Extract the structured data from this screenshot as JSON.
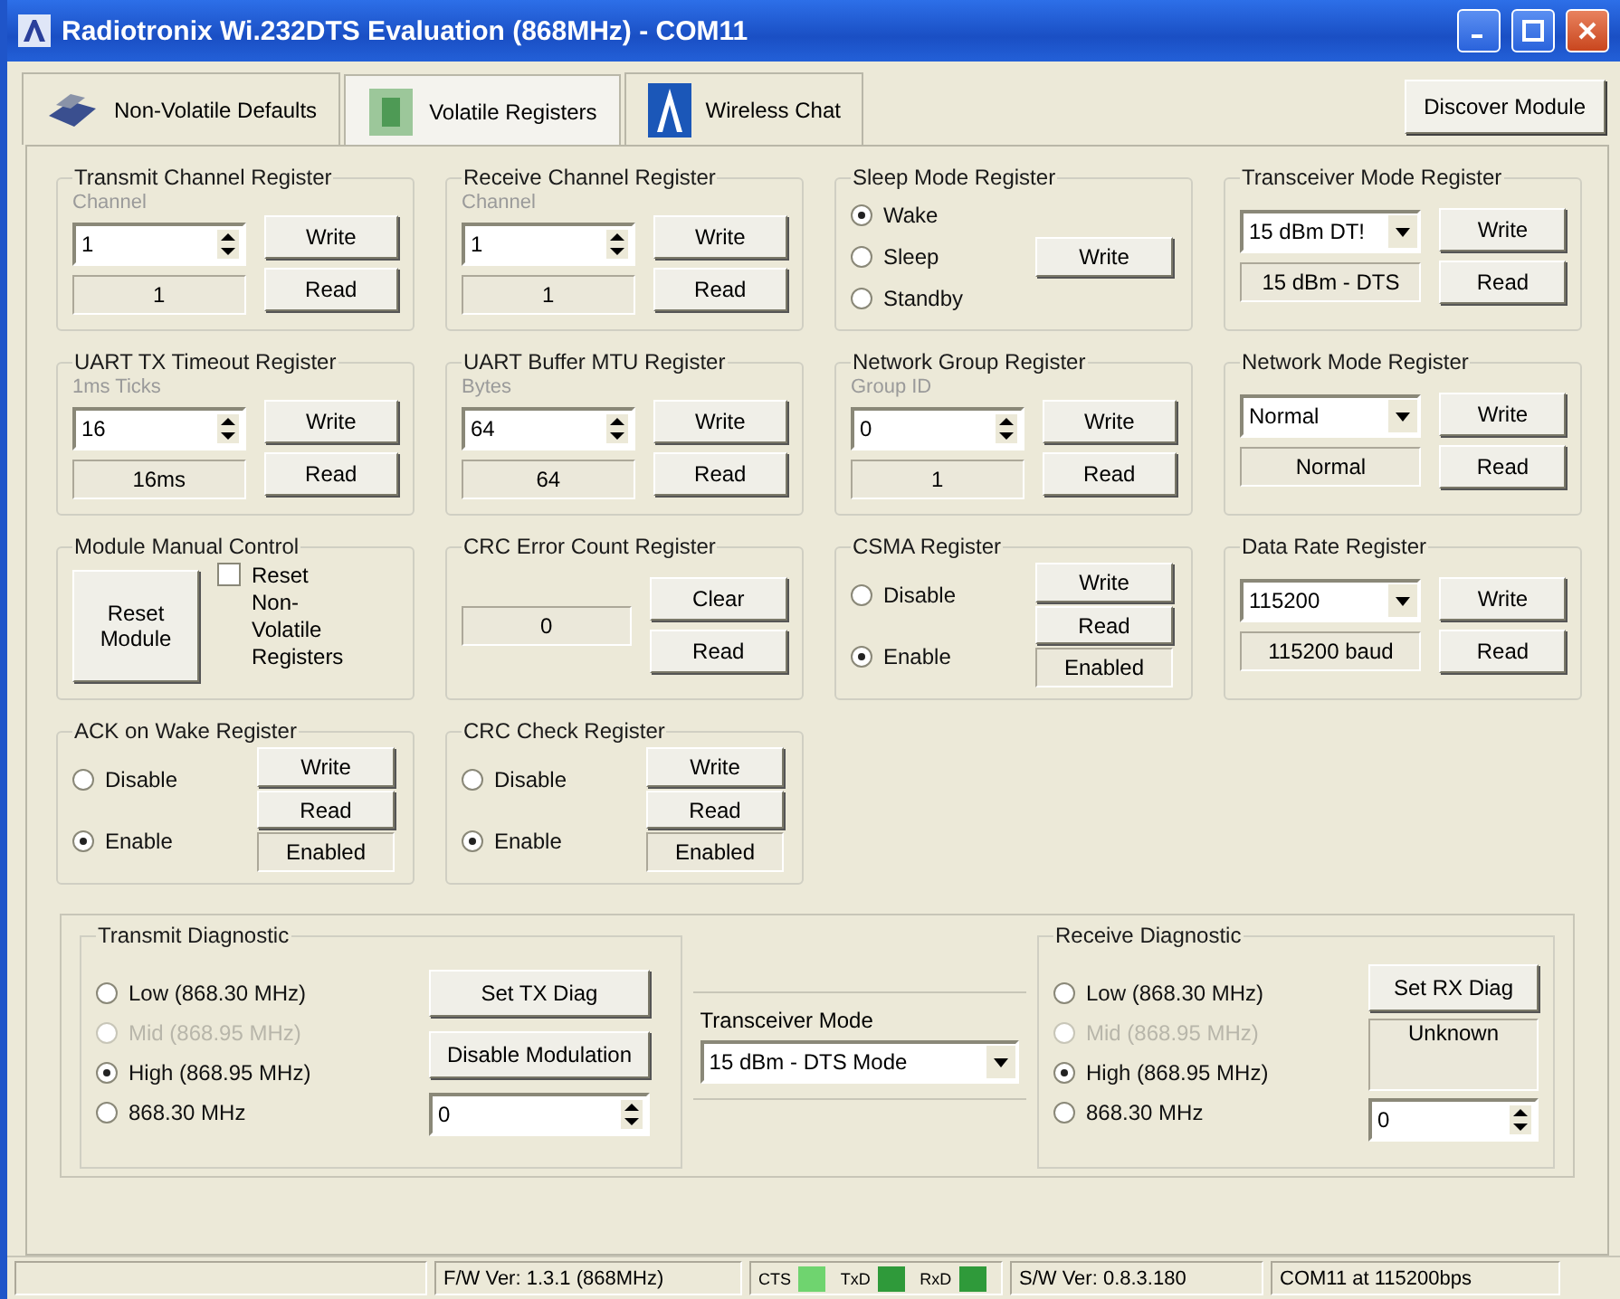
{
  "window": {
    "title": "Radiotronix Wi.232DTS Evaluation (868MHz) - COM11"
  },
  "tabs": [
    {
      "label": "Non-Volatile Defaults",
      "selected": false,
      "kind": "drive"
    },
    {
      "label": "Volatile Registers",
      "selected": true,
      "kind": "chip"
    },
    {
      "label": "Wireless Chat",
      "selected": false,
      "kind": "tower"
    }
  ],
  "discover_button": "Discover Module",
  "groups": [
    {
      "kind": "spin",
      "title": "Transmit Channel Register",
      "caption": "Channel",
      "value": "1",
      "readout": "1",
      "buttons": [
        "Write",
        "Read"
      ]
    },
    {
      "kind": "spin",
      "title": "Receive Channel Register",
      "caption": "Channel",
      "value": "1",
      "readout": "1",
      "buttons": [
        "Write",
        "Read"
      ]
    },
    {
      "kind": "radio",
      "title": "Sleep Mode Register",
      "options": [
        {
          "label": "Wake",
          "selected": true
        },
        {
          "label": "Sleep",
          "selected": false
        },
        {
          "label": "Standby",
          "selected": false
        }
      ],
      "buttons": [
        "Write"
      ]
    },
    {
      "kind": "combo",
      "title": "Transceiver Mode Register",
      "value": "15 dBm DT!",
      "readout": "15 dBm - DTS",
      "buttons": [
        "Write",
        "Read"
      ]
    },
    {
      "kind": "spin",
      "title": "UART TX Timeout Register",
      "caption": "1ms Ticks",
      "value": "16",
      "readout": "16ms",
      "buttons": [
        "Write",
        "Read"
      ]
    },
    {
      "kind": "spin",
      "title": "UART Buffer MTU Register",
      "caption": "Bytes",
      "value": "64",
      "readout": "64",
      "buttons": [
        "Write",
        "Read"
      ]
    },
    {
      "kind": "spin",
      "title": "Network Group Register",
      "caption": "Group ID",
      "value": "0",
      "readout": "1",
      "buttons": [
        "Write",
        "Read"
      ]
    },
    {
      "kind": "combo",
      "title": "Network Mode Register",
      "value": "Normal",
      "readout": "Normal",
      "buttons": [
        "Write",
        "Read"
      ]
    },
    {
      "kind": "reset",
      "title": "Module Manual Control",
      "buttons": [
        "Reset Module"
      ],
      "checkbox": {
        "label": "Reset Non-Volatile Registers",
        "checked": false
      }
    },
    {
      "kind": "counter",
      "title": "CRC Error Count Register",
      "readout": "0",
      "buttons": [
        "Clear",
        "Read"
      ]
    },
    {
      "kind": "radio",
      "title": "CSMA Register",
      "options": [
        {
          "label": "Disable",
          "selected": false
        },
        {
          "label": "Enable",
          "selected": true
        }
      ],
      "buttons": [
        "Write",
        "Read"
      ],
      "readout": "Enabled"
    },
    {
      "kind": "combo",
      "title": "Data Rate Register",
      "value": "115200",
      "readout": "115200 baud",
      "buttons": [
        "Write",
        "Read"
      ]
    },
    {
      "kind": "radio",
      "title": "ACK on Wake Register",
      "options": [
        {
          "label": "Disable",
          "selected": false
        },
        {
          "label": "Enable",
          "selected": true
        }
      ],
      "buttons": [
        "Write",
        "Read"
      ],
      "readout": "Enabled"
    },
    {
      "kind": "radio",
      "title": "CRC Check Register",
      "options": [
        {
          "label": "Disable",
          "selected": false
        },
        {
          "label": "Enable",
          "selected": true
        }
      ],
      "buttons": [
        "Write",
        "Read"
      ],
      "readout": "Enabled"
    }
  ],
  "transmit_diagnostic": {
    "title": "Transmit Diagnostic",
    "options": [
      {
        "label": "Low (868.30 MHz)",
        "selected": false,
        "disabled": false
      },
      {
        "label": "Mid (868.95 MHz)",
        "selected": false,
        "disabled": true
      },
      {
        "label": "High (868.95 MHz)",
        "selected": true,
        "disabled": false
      },
      {
        "label": "868.30 MHz",
        "selected": false,
        "disabled": false
      }
    ],
    "buttons": [
      "Set TX Diag",
      "Disable Modulation"
    ],
    "value": "0"
  },
  "transceiver_mode": {
    "label": "Transceiver Mode",
    "value": "15 dBm - DTS Mode"
  },
  "receive_diagnostic": {
    "title": "Receive Diagnostic",
    "options": [
      {
        "label": "Low (868.30 MHz)",
        "selected": false,
        "disabled": false
      },
      {
        "label": "Mid (868.95 MHz)",
        "selected": false,
        "disabled": true
      },
      {
        "label": "High (868.95 MHz)",
        "selected": true,
        "disabled": false
      },
      {
        "label": "868.30 MHz",
        "selected": false,
        "disabled": false
      }
    ],
    "button": "Set RX Diag",
    "readout": "Unknown",
    "value": "0"
  },
  "status_bar": {
    "firmware": "F/W Ver: 1.3.1 (868MHz)",
    "indicators": [
      {
        "label": "CTS",
        "color": "#6fd46f"
      },
      {
        "label": "TxD",
        "color": "#2f9a3a"
      },
      {
        "label": "RxD",
        "color": "#2f9a3a"
      }
    ],
    "software": "S/W Ver: 0.8.3.180",
    "port": "COM11 at 115200bps"
  }
}
